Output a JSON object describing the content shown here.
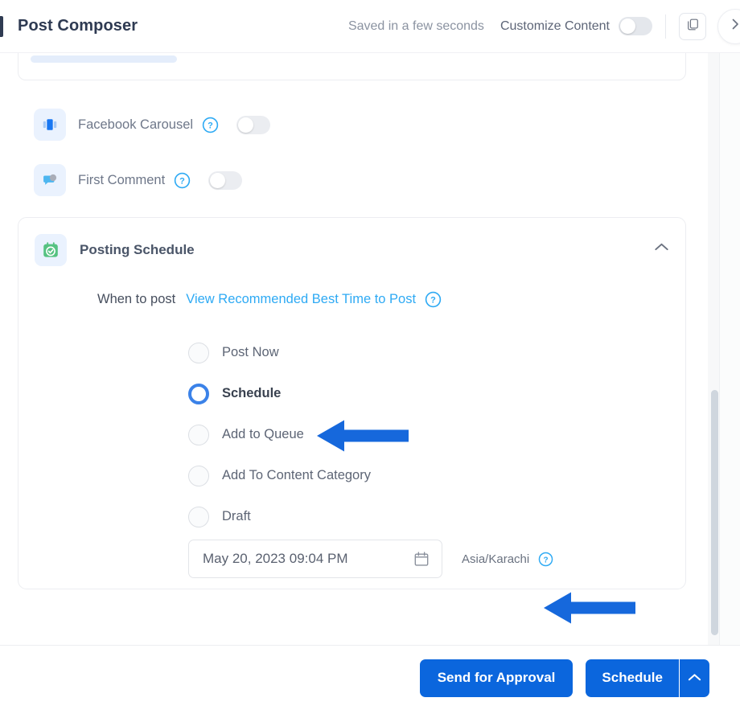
{
  "header": {
    "title": "Post Composer",
    "saved_status": "Saved in a few seconds",
    "customize_label": "Customize Content",
    "toggle_state": "off",
    "copy_icon": "copy-icon",
    "next_icon": "chevron-right-icon",
    "accent_color": "#2e3a52"
  },
  "options": [
    {
      "label": "Facebook Carousel",
      "icon": "carousel-icon",
      "help": "help-icon",
      "toggle_state": "off"
    },
    {
      "label": "First Comment",
      "icon": "comment-bubble-icon",
      "help": "help-icon",
      "toggle_state": "off"
    }
  ],
  "schedule_card": {
    "title": "Posting Schedule",
    "icon": "calendar-check-icon",
    "collapse_icon": "chevron-up-icon",
    "when_label": "When to post",
    "best_time_link": "View Recommended Best Time to Post",
    "best_time_help": "help-icon",
    "radios": [
      {
        "label": "Post Now",
        "selected": false
      },
      {
        "label": "Schedule",
        "selected": true
      },
      {
        "label": "Add to Queue",
        "selected": false
      },
      {
        "label": "Add To Content Category",
        "selected": false
      },
      {
        "label": "Draft",
        "selected": false
      }
    ],
    "date_value": "May 20, 2023 09:04 PM",
    "date_icon": "calendar-icon",
    "timezone": "Asia/Karachi",
    "timezone_help": "help-icon",
    "selected_color": "#3b82e8",
    "link_color": "#2eaaf4"
  },
  "annotations": [
    {
      "name": "arrow-pointing-to-schedule-radio",
      "direction": "left",
      "color": "#1668dc"
    },
    {
      "name": "arrow-pointing-to-timezone",
      "direction": "left",
      "color": "#1668dc"
    }
  ],
  "footer": {
    "send_for_approval": "Send for Approval",
    "schedule": "Schedule",
    "schedule_more_icon": "chevron-up-icon",
    "button_color": "#0b66dd"
  }
}
